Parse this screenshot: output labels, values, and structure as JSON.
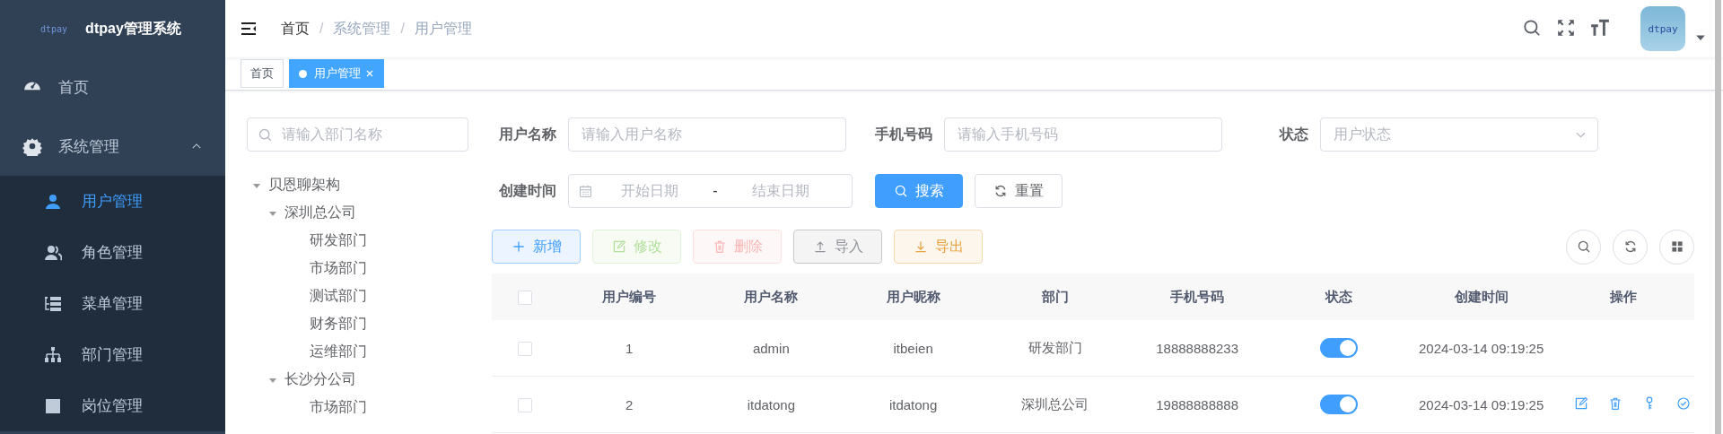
{
  "sidebar": {
    "logo_text": "dtpay",
    "title": "dtpay管理系统",
    "items": [
      {
        "label": "首页",
        "kind": "dashboard",
        "selected": false
      },
      {
        "label": "系统管理",
        "kind": "gear",
        "expanded": true,
        "selected": false,
        "children": [
          {
            "label": "用户管理",
            "kind": "user",
            "selected": true
          },
          {
            "label": "角色管理",
            "kind": "users",
            "selected": false
          },
          {
            "label": "菜单管理",
            "kind": "list",
            "selected": false
          },
          {
            "label": "部门管理",
            "kind": "org",
            "selected": false
          },
          {
            "label": "岗位管理",
            "kind": "post",
            "selected": false
          }
        ]
      }
    ]
  },
  "header": {
    "breadcrumb": [
      {
        "label": "首页"
      },
      {
        "separator": "/",
        "label": "系统管理"
      },
      {
        "separator": "/",
        "label": "用户管理"
      }
    ],
    "avatar_text": "dtpay"
  },
  "tags": [
    {
      "label": "首页",
      "selected": false,
      "closable": false
    },
    {
      "label": "用户管理",
      "selected": true,
      "closable": true
    }
  ],
  "dept_tree": {
    "search": {
      "placeholder": "请输入部门名称"
    },
    "nodes": [
      {
        "label": "贝恩聊架构",
        "expanded": true,
        "children": [
          {
            "label": "深圳总公司",
            "expanded": true,
            "children": [
              {
                "label": "研发部门"
              },
              {
                "label": "市场部门"
              },
              {
                "label": "测试部门"
              },
              {
                "label": "财务部门"
              },
              {
                "label": "运维部门"
              }
            ]
          },
          {
            "label": "长沙分公司",
            "expanded": true,
            "children": [
              {
                "label": "市场部门"
              }
            ]
          }
        ]
      }
    ]
  },
  "filters": [
    {
      "label": "用户名称",
      "kind": "input",
      "placeholder": "请输入用户名称"
    },
    {
      "label": "手机号码",
      "kind": "input",
      "placeholder": "请输入手机号码"
    },
    {
      "label": "状态",
      "kind": "select",
      "placeholder": "用户状态"
    },
    {
      "label": "创建时间",
      "kind": "daterange",
      "start_placeholder": "开始日期",
      "separator": "-",
      "end_placeholder": "结束日期"
    }
  ],
  "filter_buttons": [
    {
      "label": "搜索",
      "kind": "search"
    },
    {
      "label": "重置",
      "kind": "reset"
    }
  ],
  "toolbar": [
    {
      "label": "新增",
      "kind": "add",
      "disabled": false
    },
    {
      "label": "修改",
      "kind": "edit",
      "disabled": true
    },
    {
      "label": "删除",
      "kind": "delete",
      "disabled": true
    },
    {
      "label": "导入",
      "kind": "import",
      "disabled": false
    },
    {
      "label": "导出",
      "kind": "export",
      "disabled": false
    }
  ],
  "table": {
    "select_all_checked": false,
    "columns": [
      "用户编号",
      "用户名称",
      "用户昵称",
      "部门",
      "手机号码",
      "状态",
      "创建时间",
      "操作"
    ],
    "rows": [
      {
        "checked": false,
        "cells": [
          "1",
          "admin",
          "itbeien",
          "研发部门",
          "18888888233"
        ],
        "on": true,
        "created": "2024-03-14 09:19:25",
        "actions": false
      },
      {
        "checked": false,
        "cells": [
          "2",
          "itdatong",
          "itdatong",
          "深圳总公司",
          "19888888888"
        ],
        "on": true,
        "created": "2024-03-14 09:19:25",
        "actions": true
      }
    ]
  }
}
